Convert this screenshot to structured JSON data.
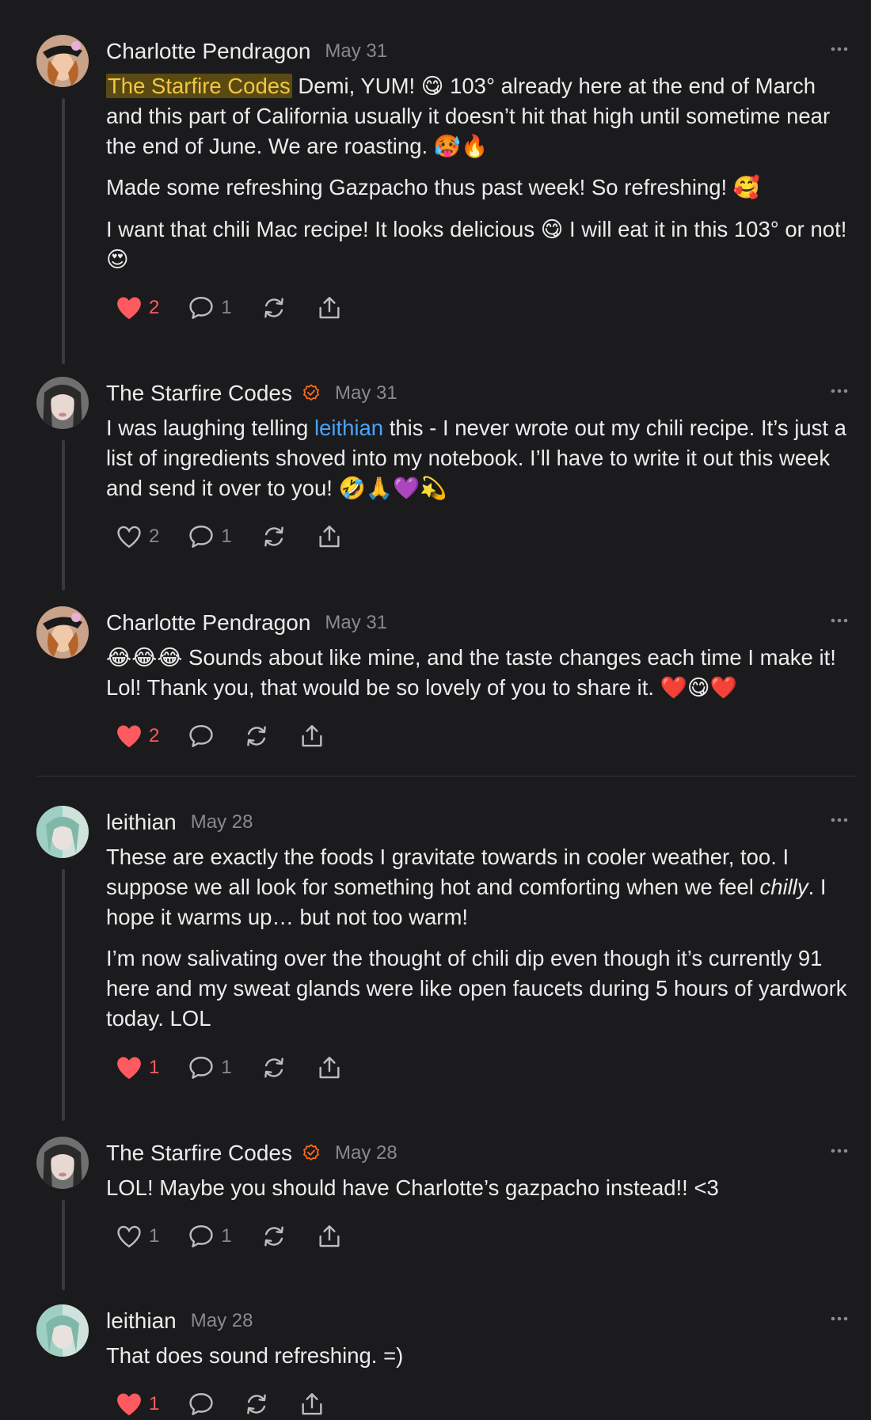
{
  "comments": [
    {
      "author": "Charlotte Pendragon",
      "date": "May 31",
      "verified": false,
      "avatar": "avatar-charlotte",
      "paragraphs": [
        {
          "mention_highlight": "The Starfire Codes",
          "text": " Demi, YUM! 😋 103° already here at the end of March and this part of California usually it doesn’t hit that high until sometime near the end of June. We are roasting. 🥵🔥"
        },
        {
          "text": "Made some refreshing Gazpacho thus past week! So refreshing! 🥰"
        },
        {
          "text": "I want that chili Mac recipe! It looks delicious 😋 I will eat it in this 103° or not! 😍"
        }
      ],
      "likes": "2",
      "liked": true,
      "replies": "1"
    },
    {
      "author": "The Starfire Codes",
      "date": "May 31",
      "verified": true,
      "avatar": "avatar-starfire",
      "paragraphs": [
        {
          "pre": "I was laughing telling ",
          "mention": "leithian",
          "text": " this - I never wrote out my chili recipe. It’s just a list of ingredients shoved into my notebook. I’ll have to write it out this week and send it over to you! 🤣🙏💜💫"
        }
      ],
      "likes": "2",
      "liked": false,
      "replies": "1"
    },
    {
      "author": "Charlotte Pendragon",
      "date": "May 31",
      "verified": false,
      "avatar": "avatar-charlotte",
      "paragraphs": [
        {
          "text": "😂😂😂 Sounds about like mine, and the taste changes each time I make it! Lol! Thank you, that would be so lovely of you to share it. ❤️😋❤️"
        }
      ],
      "likes": "2",
      "liked": true,
      "replies": ""
    },
    {
      "author": "leithian",
      "date": "May 28",
      "verified": false,
      "avatar": "avatar-leithian",
      "paragraphs": [
        {
          "pre": "These are exactly the foods I gravitate towards in cooler weather, too. I suppose we all look for something hot and comforting when we feel ",
          "italic": "chilly",
          "text": ". I hope it warms up… but not too warm!"
        },
        {
          "text": "I’m now salivating over the thought of chili dip even though it’s currently 91 here and my sweat glands were like open faucets during 5 hours of yardwork today. LOL"
        }
      ],
      "likes": "1",
      "liked": true,
      "replies": "1"
    },
    {
      "author": "The Starfire Codes",
      "date": "May 28",
      "verified": true,
      "avatar": "avatar-starfire",
      "paragraphs": [
        {
          "text": "LOL! Maybe you should have Charlotte’s gazpacho instead!! <3"
        }
      ],
      "likes": "1",
      "liked": false,
      "replies": "1"
    },
    {
      "author": "leithian",
      "date": "May 28",
      "verified": false,
      "avatar": "avatar-leithian",
      "paragraphs": [
        {
          "text": "That does sound refreshing. =)"
        }
      ],
      "likes": "1",
      "liked": true,
      "replies": ""
    }
  ],
  "colors": {
    "background": "#1b1b1d",
    "liked": "#ff5a5f",
    "verified": "#ff6a1a",
    "mention": "#4aa3ff",
    "highlight": "#f2c744"
  }
}
